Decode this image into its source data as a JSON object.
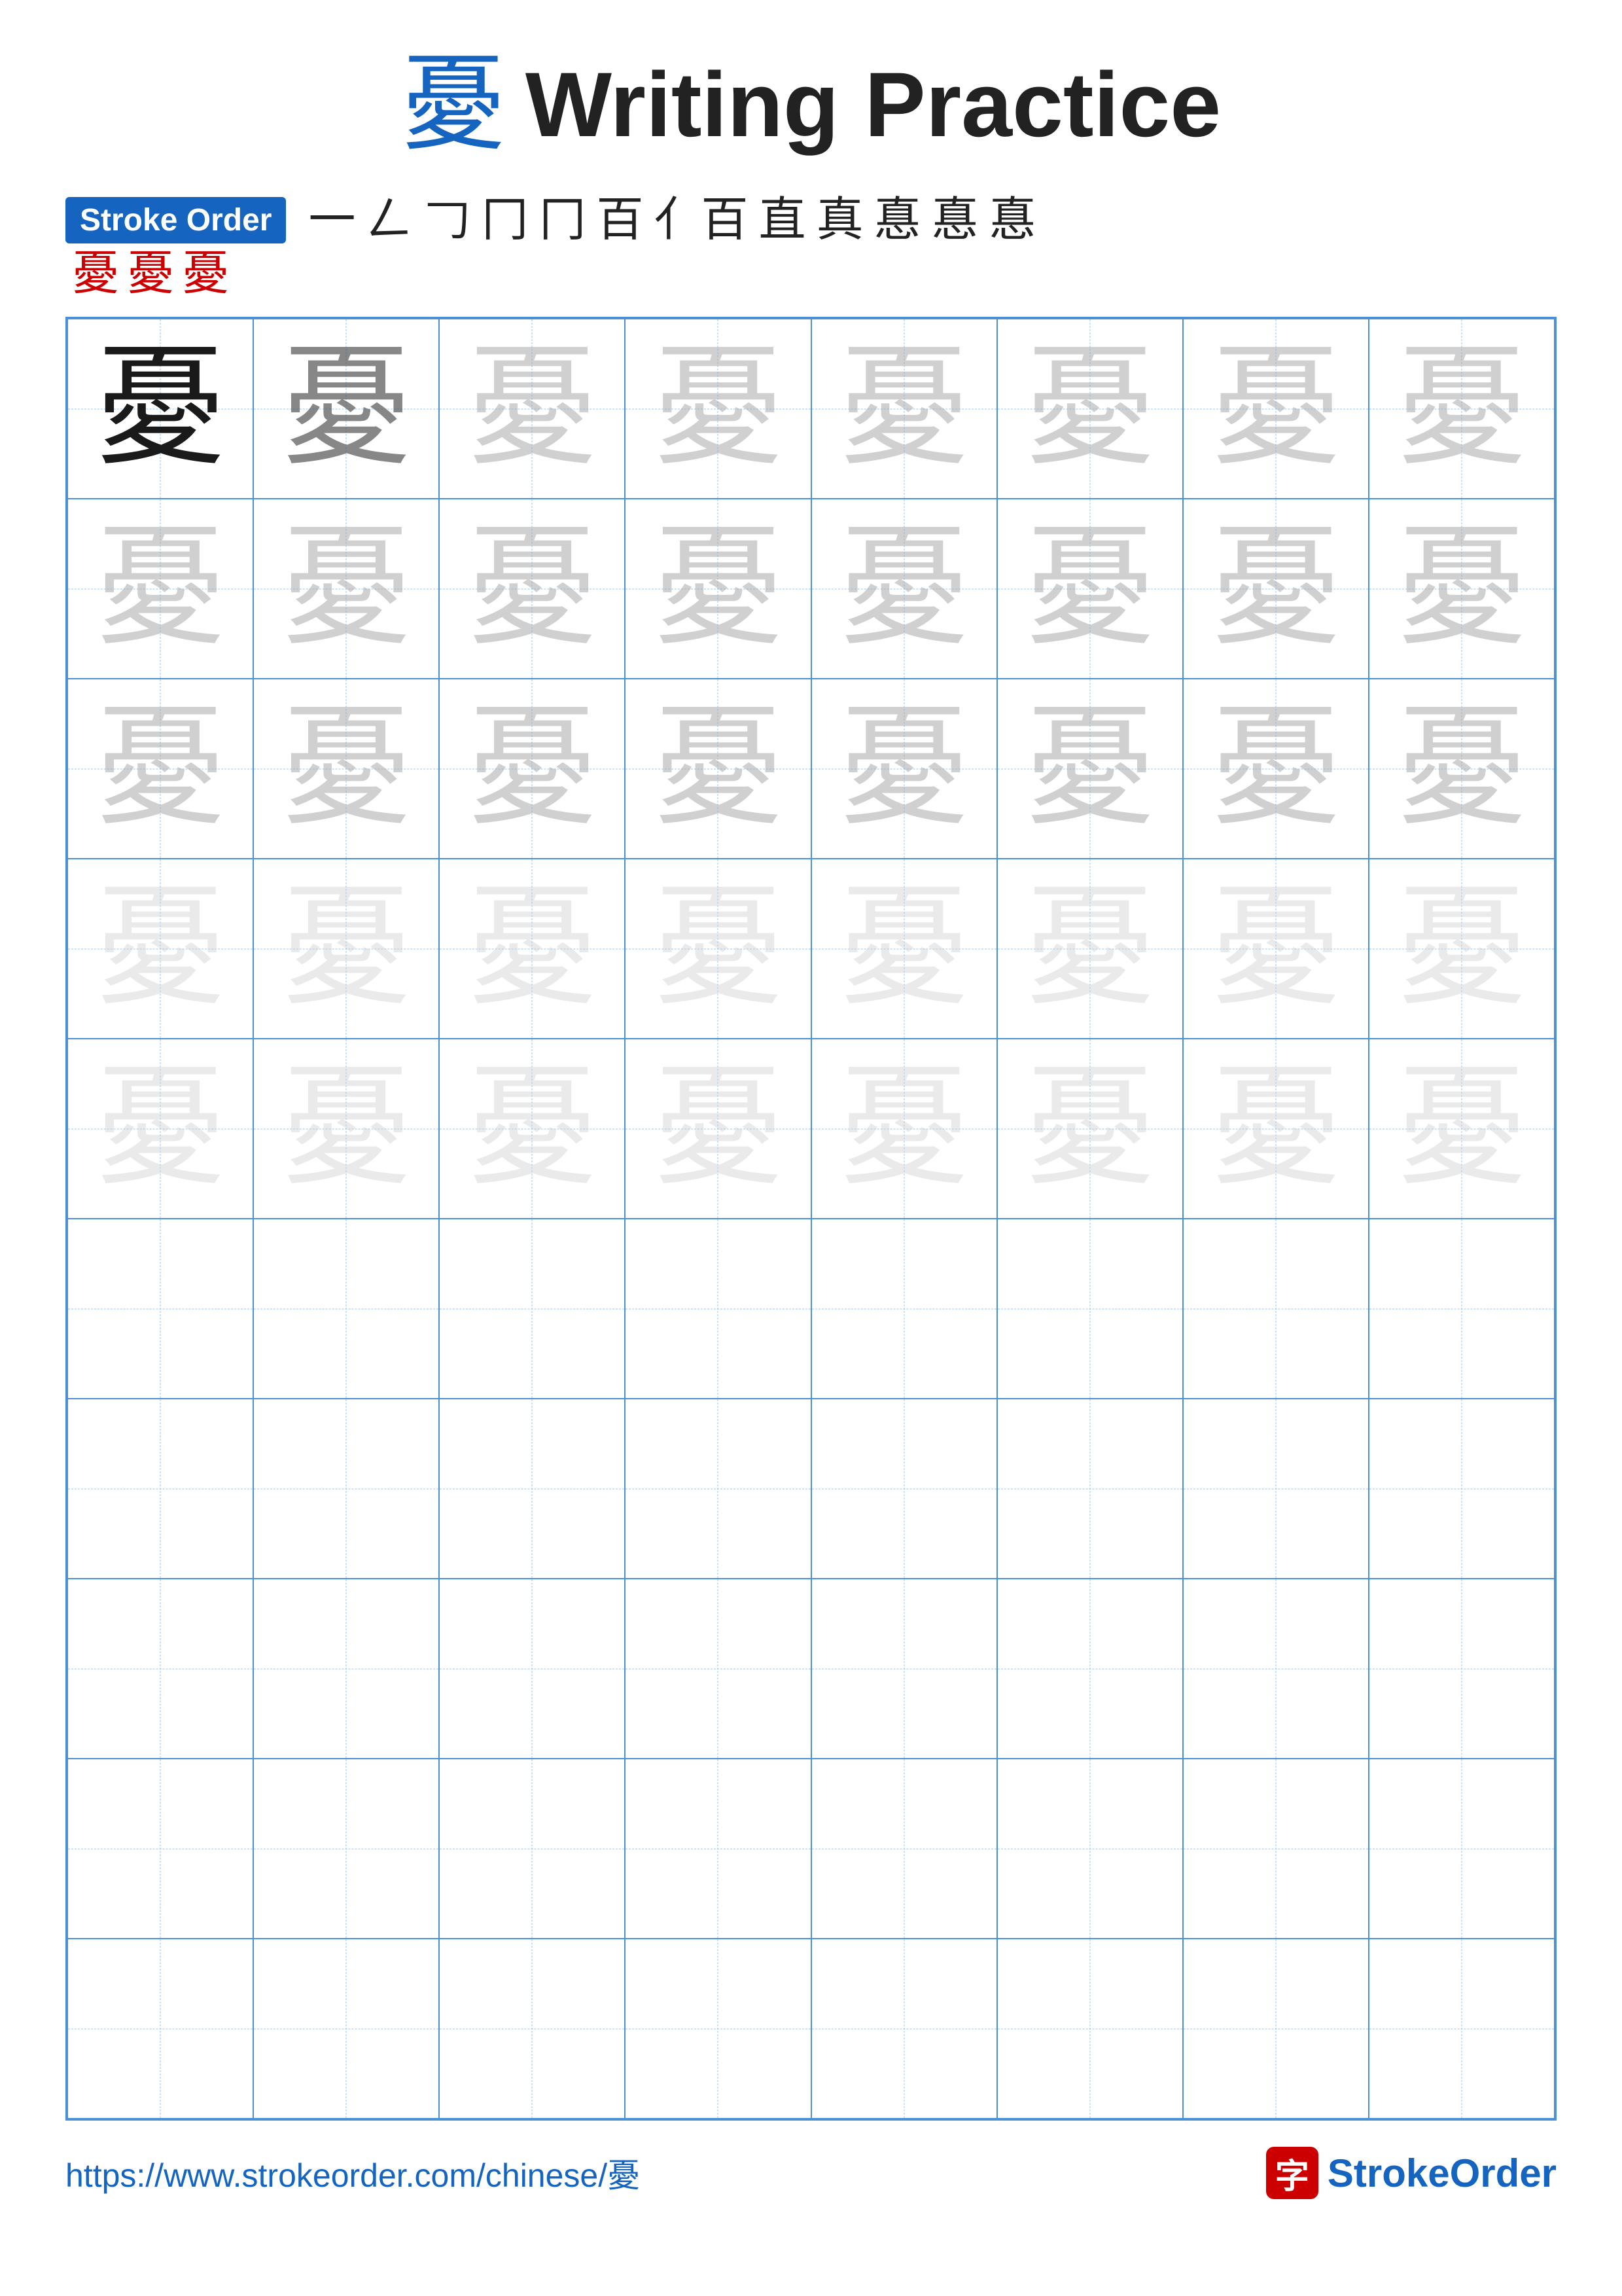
{
  "title": {
    "char": "憂",
    "text": "Writing Practice"
  },
  "stroke_order": {
    "label": "Stroke Order",
    "strokes_row1": [
      "一",
      "𠃋",
      "𠃌",
      "冂",
      "冂",
      "百",
      "亻百",
      "直",
      "真",
      "惪",
      "惪",
      "惪"
    ],
    "strokes_row2": [
      "憂",
      "憂",
      "憂"
    ],
    "red_indices_row2": [
      0,
      1,
      2
    ]
  },
  "grid": {
    "cols": 8,
    "rows": 10,
    "char": "憂",
    "filled_rows": 5,
    "opacities": [
      [
        "dark",
        "medium-dark",
        "light",
        "light",
        "light",
        "light",
        "light",
        "light"
      ],
      [
        "light",
        "light",
        "light",
        "light",
        "light",
        "light",
        "light",
        "light"
      ],
      [
        "light",
        "light",
        "light",
        "light",
        "light",
        "light",
        "light",
        "light"
      ],
      [
        "very-light",
        "very-light",
        "very-light",
        "very-light",
        "very-light",
        "very-light",
        "very-light",
        "very-light"
      ],
      [
        "very-light",
        "very-light",
        "very-light",
        "very-light",
        "very-light",
        "very-light",
        "very-light",
        "very-light"
      ],
      [
        "empty",
        "empty",
        "empty",
        "empty",
        "empty",
        "empty",
        "empty",
        "empty"
      ],
      [
        "empty",
        "empty",
        "empty",
        "empty",
        "empty",
        "empty",
        "empty",
        "empty"
      ],
      [
        "empty",
        "empty",
        "empty",
        "empty",
        "empty",
        "empty",
        "empty",
        "empty"
      ],
      [
        "empty",
        "empty",
        "empty",
        "empty",
        "empty",
        "empty",
        "empty",
        "empty"
      ],
      [
        "empty",
        "empty",
        "empty",
        "empty",
        "empty",
        "empty",
        "empty",
        "empty"
      ]
    ]
  },
  "footer": {
    "url": "https://www.strokeorder.com/chinese/憂",
    "logo_icon": "字",
    "logo_text_plain": "StrokeOrder",
    "logo_brand_prefix": ""
  }
}
